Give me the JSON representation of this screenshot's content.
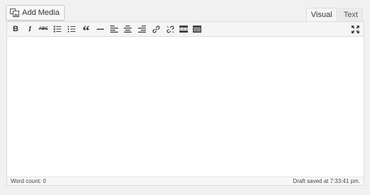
{
  "media": {
    "add_label": "Add Media"
  },
  "tabs": [
    {
      "label": "Visual",
      "active": true
    },
    {
      "label": "Text",
      "active": false
    }
  ],
  "toolbar": {
    "bold_glyph": "B",
    "italic_glyph": "I",
    "strike_glyph": "ABC",
    "quote_glyph": "“"
  },
  "status": {
    "word_count": "Word count: 0",
    "draft_saved": "Draft saved at 7:33:41 pm."
  }
}
